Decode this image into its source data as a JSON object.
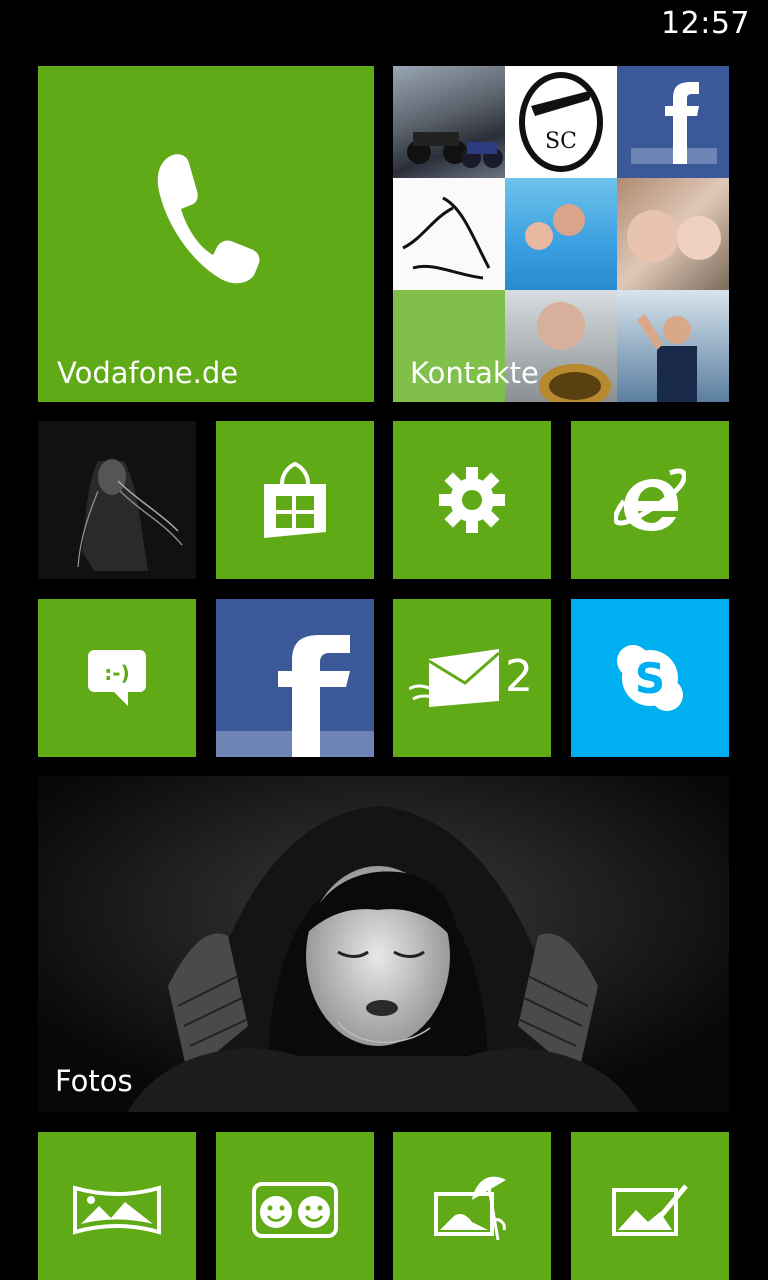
{
  "status_bar": {
    "time": "12:57"
  },
  "tiles": {
    "phone": {
      "label": "Vodafone.de",
      "icon": "phone-icon"
    },
    "contacts": {
      "label": "Kontakte",
      "icon": "people-photos"
    },
    "music": {
      "icon": "music-photo"
    },
    "store": {
      "icon": "store-icon"
    },
    "settings": {
      "icon": "gear-icon"
    },
    "internet_explorer": {
      "icon": "ie-icon"
    },
    "messaging": {
      "icon": "messaging-smiley-icon"
    },
    "facebook": {
      "icon": "facebook-icon"
    },
    "mail": {
      "icon": "outlook-mail-icon",
      "count": "2"
    },
    "skype": {
      "icon": "skype-icon"
    },
    "photos": {
      "label": "Fotos"
    },
    "bottom_row": [
      {
        "icon": "panorama-icon"
      },
      {
        "icon": "smiley-camera-icon"
      },
      {
        "icon": "photo-beach-icon"
      },
      {
        "icon": "photo-edit-icon"
      }
    ]
  },
  "colors": {
    "tile_green": "#60a917",
    "facebook_blue": "#3b5998",
    "skype_blue": "#00aff0",
    "background": "#000000"
  }
}
